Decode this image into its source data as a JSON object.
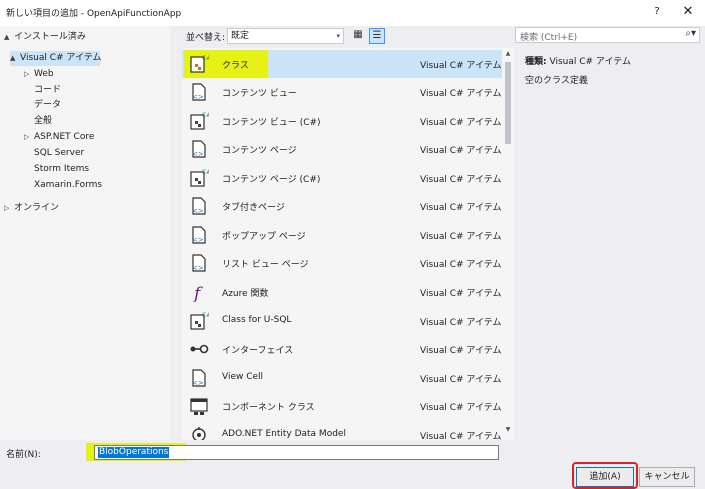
{
  "window": {
    "title": "新しい項目の追加 - OpenApiFunctionApp",
    "help_glyph": "?",
    "close_glyph": "✕"
  },
  "tree": {
    "installed": "インストール済み",
    "items": [
      {
        "label": "Visual C# アイテム",
        "arrow": "▲"
      },
      {
        "label": "Web",
        "arrow": "▷"
      },
      {
        "label": "コード",
        "arrow": ""
      },
      {
        "label": "データ",
        "arrow": ""
      },
      {
        "label": "全般",
        "arrow": ""
      },
      {
        "label": "ASP.NET Core",
        "arrow": "▷"
      },
      {
        "label": "SQL Server",
        "arrow": ""
      },
      {
        "label": "Storm Items",
        "arrow": ""
      },
      {
        "label": "Xamarin.Forms",
        "arrow": ""
      }
    ],
    "online": "オンライン",
    "installed_arrow": "▲",
    "online_arrow": "▷"
  },
  "sort": {
    "label": "並べ替え:",
    "value": "既定",
    "dropdown_glyph": "▾",
    "grid_glyph": "▦",
    "list_glyph": "☰"
  },
  "templates": [
    {
      "name": "クラス",
      "type": "Visual C# アイテム",
      "icon": "class-icon"
    },
    {
      "name": "コンテンツ ビュー",
      "type": "Visual C# アイテム",
      "icon": "xaml-page-icon"
    },
    {
      "name": "コンテンツ ビュー (C#)",
      "type": "Visual C# アイテム",
      "icon": "csharp-page-icon"
    },
    {
      "name": "コンテンツ ページ",
      "type": "Visual C# アイテム",
      "icon": "xaml-page-icon"
    },
    {
      "name": "コンテンツ ページ (C#)",
      "type": "Visual C# アイテム",
      "icon": "csharp-page-icon"
    },
    {
      "name": "タブ付きページ",
      "type": "Visual C# アイテム",
      "icon": "xaml-page-icon"
    },
    {
      "name": "ポップアップ ページ",
      "type": "Visual C# アイテム",
      "icon": "xaml-page-icon"
    },
    {
      "name": "リスト ビュー ページ",
      "type": "Visual C# アイテム",
      "icon": "xaml-page-icon"
    },
    {
      "name": "Azure 関数",
      "type": "Visual C# アイテム",
      "icon": "function-icon"
    },
    {
      "name": "Class for U-SQL",
      "type": "Visual C# アイテム",
      "icon": "csharp-page-icon"
    },
    {
      "name": "インターフェイス",
      "type": "Visual C# アイテム",
      "icon": "interface-icon"
    },
    {
      "name": "View Cell",
      "type": "Visual C# アイテム",
      "icon": "xaml-page-icon"
    },
    {
      "name": "コンポーネント クラス",
      "type": "Visual C# アイテム",
      "icon": "component-icon"
    },
    {
      "name": "ADO.NET Entity Data Model",
      "type": "Visual C# アイテム",
      "icon": "entity-model-icon"
    }
  ],
  "search": {
    "placeholder": "検索 (Ctrl+E)",
    "icon_glyph": "⌕▾"
  },
  "details": {
    "type_label": "種類:",
    "type_value": "Visual C# アイテム",
    "description": "空のクラス定義"
  },
  "name_field": {
    "label": "名前(N):",
    "value": "BlobOperations"
  },
  "buttons": {
    "add": "追加(A)",
    "cancel": "キャンセル"
  },
  "colors": {
    "selection": "#cce4f7",
    "highlight": "#e6f214",
    "accent": "#0078d7",
    "callout": "#e02020"
  }
}
